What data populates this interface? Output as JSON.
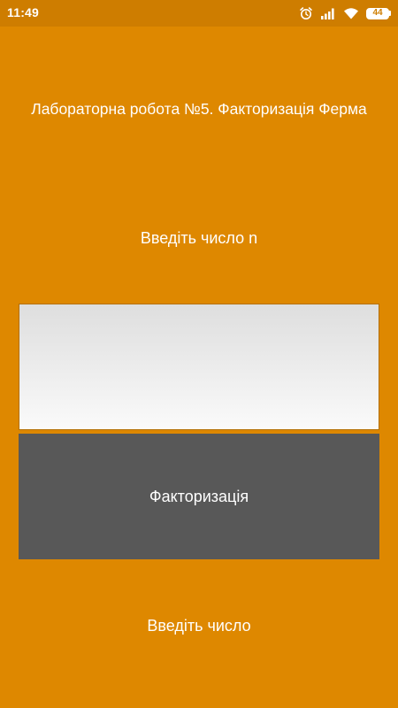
{
  "status_bar": {
    "time": "11:49",
    "battery_level": "44",
    "icons": [
      "alarm-icon",
      "signal-icon",
      "wifi-icon",
      "battery-icon"
    ]
  },
  "main": {
    "title": "Лабораторна робота №5. Факторизація Ферма",
    "input_prompt": "Введіть число n",
    "number_input_value": "",
    "factor_button_label": "Факторизація",
    "result_text": "Введіть число"
  },
  "colors": {
    "background": "#de8800",
    "status_bar": "#ce7d00",
    "button": "#585858",
    "text": "#ffffff"
  }
}
